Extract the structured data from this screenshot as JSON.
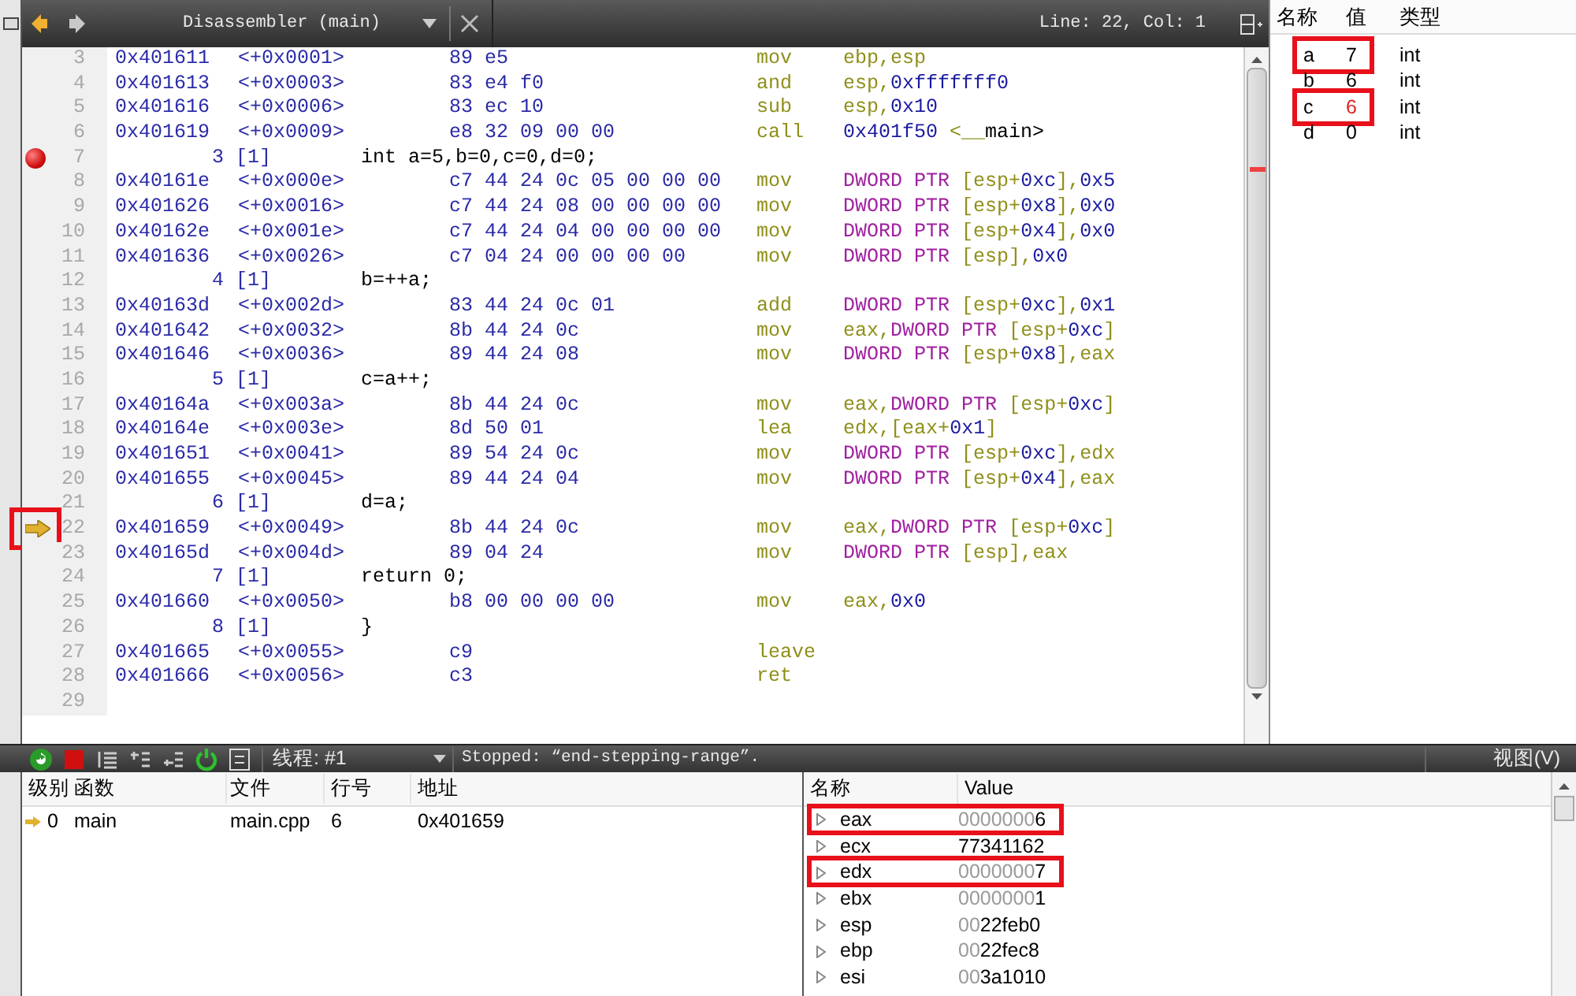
{
  "editor": {
    "tab_title": "Disassembler (main)",
    "position": "Line: 22, Col: 1",
    "lines": [
      {
        "n": "3",
        "kind": "asm",
        "addr": "0x401611",
        "off": "<+0x0001>",
        "bytes": "89 e5",
        "op": "mov",
        "args": "ebp,esp",
        "breakpoint": false,
        "current": false,
        "highlighted": false
      },
      {
        "n": "4",
        "kind": "asm",
        "addr": "0x401613",
        "off": "<+0x0003>",
        "bytes": "83 e4 f0",
        "op": "and",
        "args": "esp,0xfffffff0",
        "breakpoint": false,
        "current": false,
        "highlighted": false
      },
      {
        "n": "5",
        "kind": "asm",
        "addr": "0x401616",
        "off": "<+0x0006>",
        "bytes": "83 ec 10",
        "op": "sub",
        "args": "esp,0x10",
        "breakpoint": false,
        "current": false,
        "highlighted": false
      },
      {
        "n": "6",
        "kind": "asm",
        "addr": "0x401619",
        "off": "<+0x0009>",
        "bytes": "e8 32 09 00 00",
        "op": "call",
        "args": "0x401f50 <__main>",
        "breakpoint": false,
        "current": false,
        "highlighted": false
      },
      {
        "n": "7",
        "kind": "src",
        "line": "3 [1]",
        "code": "int a=5,b=0,c=0,d=0;",
        "breakpoint": true,
        "current": false,
        "highlighted": false
      },
      {
        "n": "8",
        "kind": "asm",
        "addr": "0x40161e",
        "off": "<+0x000e>",
        "bytes": "c7 44 24 0c 05 00 00 00",
        "op": "mov",
        "args": "DWORD PTR [esp+0xc],0x5",
        "breakpoint": false,
        "current": false,
        "highlighted": false
      },
      {
        "n": "9",
        "kind": "asm",
        "addr": "0x401626",
        "off": "<+0x0016>",
        "bytes": "c7 44 24 08 00 00 00 00",
        "op": "mov",
        "args": "DWORD PTR [esp+0x8],0x0",
        "breakpoint": false,
        "current": false,
        "highlighted": false
      },
      {
        "n": "10",
        "kind": "asm",
        "addr": "0x40162e",
        "off": "<+0x001e>",
        "bytes": "c7 44 24 04 00 00 00 00",
        "op": "mov",
        "args": "DWORD PTR [esp+0x4],0x0",
        "breakpoint": false,
        "current": false,
        "highlighted": false
      },
      {
        "n": "11",
        "kind": "asm",
        "addr": "0x401636",
        "off": "<+0x0026>",
        "bytes": "c7 04 24 00 00 00 00",
        "op": "mov",
        "args": "DWORD PTR [esp],0x0",
        "breakpoint": false,
        "current": false,
        "highlighted": false
      },
      {
        "n": "12",
        "kind": "src",
        "line": "4 [1]",
        "code": "b=++a;",
        "breakpoint": false,
        "current": false,
        "highlighted": false
      },
      {
        "n": "13",
        "kind": "asm",
        "addr": "0x40163d",
        "off": "<+0x002d>",
        "bytes": "83 44 24 0c 01",
        "op": "add",
        "args": "DWORD PTR [esp+0xc],0x1",
        "breakpoint": false,
        "current": false,
        "highlighted": false
      },
      {
        "n": "14",
        "kind": "asm",
        "addr": "0x401642",
        "off": "<+0x0032>",
        "bytes": "8b 44 24 0c",
        "op": "mov",
        "args": "eax,DWORD PTR [esp+0xc]",
        "breakpoint": false,
        "current": false,
        "highlighted": false
      },
      {
        "n": "15",
        "kind": "asm",
        "addr": "0x401646",
        "off": "<+0x0036>",
        "bytes": "89 44 24 08",
        "op": "mov",
        "args": "DWORD PTR [esp+0x8],eax",
        "breakpoint": false,
        "current": false,
        "highlighted": false
      },
      {
        "n": "16",
        "kind": "src",
        "line": "5 [1]",
        "code": "c=a++;",
        "breakpoint": false,
        "current": false,
        "highlighted": false
      },
      {
        "n": "17",
        "kind": "asm",
        "addr": "0x40164a",
        "off": "<+0x003a>",
        "bytes": "8b 44 24 0c",
        "op": "mov",
        "args": "eax,DWORD PTR [esp+0xc]",
        "breakpoint": false,
        "current": false,
        "highlighted": false
      },
      {
        "n": "18",
        "kind": "asm",
        "addr": "0x40164e",
        "off": "<+0x003e>",
        "bytes": "8d 50 01",
        "op": "lea",
        "args": "edx,[eax+0x1]",
        "breakpoint": false,
        "current": false,
        "highlighted": false
      },
      {
        "n": "19",
        "kind": "asm",
        "addr": "0x401651",
        "off": "<+0x0041>",
        "bytes": "89 54 24 0c",
        "op": "mov",
        "args": "DWORD PTR [esp+0xc],edx",
        "breakpoint": false,
        "current": false,
        "highlighted": false
      },
      {
        "n": "20",
        "kind": "asm",
        "addr": "0x401655",
        "off": "<+0x0045>",
        "bytes": "89 44 24 04",
        "op": "mov",
        "args": "DWORD PTR [esp+0x4],eax",
        "breakpoint": false,
        "current": false,
        "highlighted": false
      },
      {
        "n": "21",
        "kind": "src",
        "line": "6 [1]",
        "code": "d=a;",
        "breakpoint": false,
        "current": false,
        "highlighted": false
      },
      {
        "n": "22",
        "kind": "asm",
        "addr": "0x401659",
        "off": "<+0x0049>",
        "bytes": "8b 44 24 0c",
        "op": "mov",
        "args": "eax,DWORD PTR [esp+0xc]",
        "breakpoint": false,
        "current": true,
        "highlighted": true
      },
      {
        "n": "23",
        "kind": "asm",
        "addr": "0x40165d",
        "off": "<+0x004d>",
        "bytes": "89 04 24",
        "op": "mov",
        "args": "DWORD PTR [esp],eax",
        "breakpoint": false,
        "current": false,
        "highlighted": false
      },
      {
        "n": "24",
        "kind": "src",
        "line": "7 [1]",
        "code": "return 0;",
        "breakpoint": false,
        "current": false,
        "highlighted": false
      },
      {
        "n": "25",
        "kind": "asm",
        "addr": "0x401660",
        "off": "<+0x0050>",
        "bytes": "b8 00 00 00 00",
        "op": "mov",
        "args": "eax,0x0",
        "breakpoint": false,
        "current": false,
        "highlighted": false
      },
      {
        "n": "26",
        "kind": "src",
        "line": "8 [1]",
        "code": "}",
        "breakpoint": false,
        "current": false,
        "highlighted": false
      },
      {
        "n": "27",
        "kind": "asm",
        "addr": "0x401665",
        "off": "<+0x0055>",
        "bytes": "c9",
        "op": "leave",
        "breakpoint": false,
        "current": false,
        "highlighted": false
      },
      {
        "n": "28",
        "kind": "asm",
        "addr": "0x401666",
        "off": "<+0x0056>",
        "bytes": "c3",
        "op": "ret",
        "breakpoint": false,
        "current": false,
        "highlighted": false
      },
      {
        "n": "29",
        "kind": "blank",
        "breakpoint": false,
        "current": false,
        "highlighted": false
      }
    ]
  },
  "watch": {
    "columns": [
      "名称",
      "值",
      "类型"
    ],
    "rows": [
      {
        "name": "a",
        "value": "7",
        "type": "int",
        "changed": false,
        "highlighted": true
      },
      {
        "name": "b",
        "value": "6",
        "type": "int",
        "changed": false,
        "highlighted": false
      },
      {
        "name": "c",
        "value": "6",
        "type": "int",
        "changed": true,
        "highlighted": true
      },
      {
        "name": "d",
        "value": "0",
        "type": "int",
        "changed": false,
        "highlighted": false
      }
    ]
  },
  "debug_toolbar": {
    "thread_label": "线程: #1",
    "status": "Stopped: “end-stepping-range”.",
    "view_menu": "视图(V)"
  },
  "call_stack": {
    "columns": [
      "级别",
      "函数",
      "文件",
      "行号",
      "地址"
    ],
    "rows": [
      {
        "level": "0",
        "function": "main",
        "file": "main.cpp",
        "line": "6",
        "address": "0x401659",
        "current": true
      }
    ]
  },
  "registers": {
    "columns": [
      "名称",
      "Value"
    ],
    "rows": [
      {
        "name": "eax",
        "value": "00000006",
        "highlighted": true
      },
      {
        "name": "ecx",
        "value": "77341162",
        "highlighted": false
      },
      {
        "name": "edx",
        "value": "00000007",
        "highlighted": true
      },
      {
        "name": "ebx",
        "value": "00000001",
        "highlighted": false
      },
      {
        "name": "esp",
        "value": "0022feb0",
        "highlighted": false
      },
      {
        "name": "ebp",
        "value": "0022fec8",
        "highlighted": false
      },
      {
        "name": "esi",
        "value": "003a1010",
        "highlighted": false
      }
    ]
  }
}
